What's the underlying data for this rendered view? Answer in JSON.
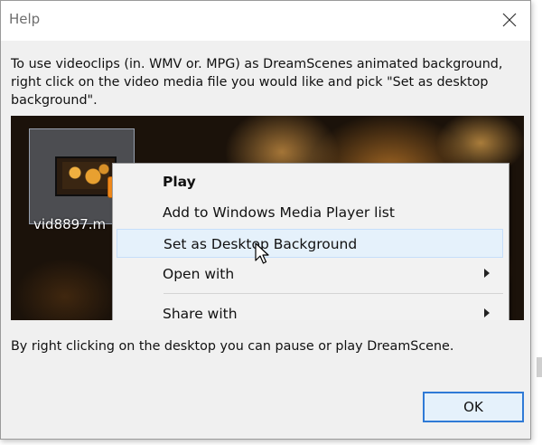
{
  "window": {
    "title": "Help"
  },
  "instructions": "To use videoclips (in. WMV or. MPG) as DreamScenes animated background, right click on the video media file you would like and pick \"Set as desktop background\".",
  "preview": {
    "file_name": "vid8897.m",
    "context_menu": {
      "items": [
        {
          "label": "Play",
          "bold": true,
          "submenu": false
        },
        {
          "label": "Add to Windows Media Player list",
          "bold": false,
          "submenu": false
        },
        {
          "label": "Set as Desktop Background",
          "bold": false,
          "submenu": false,
          "highlighted": true
        },
        {
          "label": "Open with",
          "bold": false,
          "submenu": true
        },
        {
          "label": "Share with",
          "bold": false,
          "submenu": true
        }
      ]
    }
  },
  "footer": "By right clicking on the desktop you can pause or play DreamScene.",
  "buttons": {
    "ok": "OK"
  },
  "colors": {
    "accent": "#2f7ad6",
    "highlight": "#e5f1fb",
    "play_badge": "#f28a1c"
  }
}
